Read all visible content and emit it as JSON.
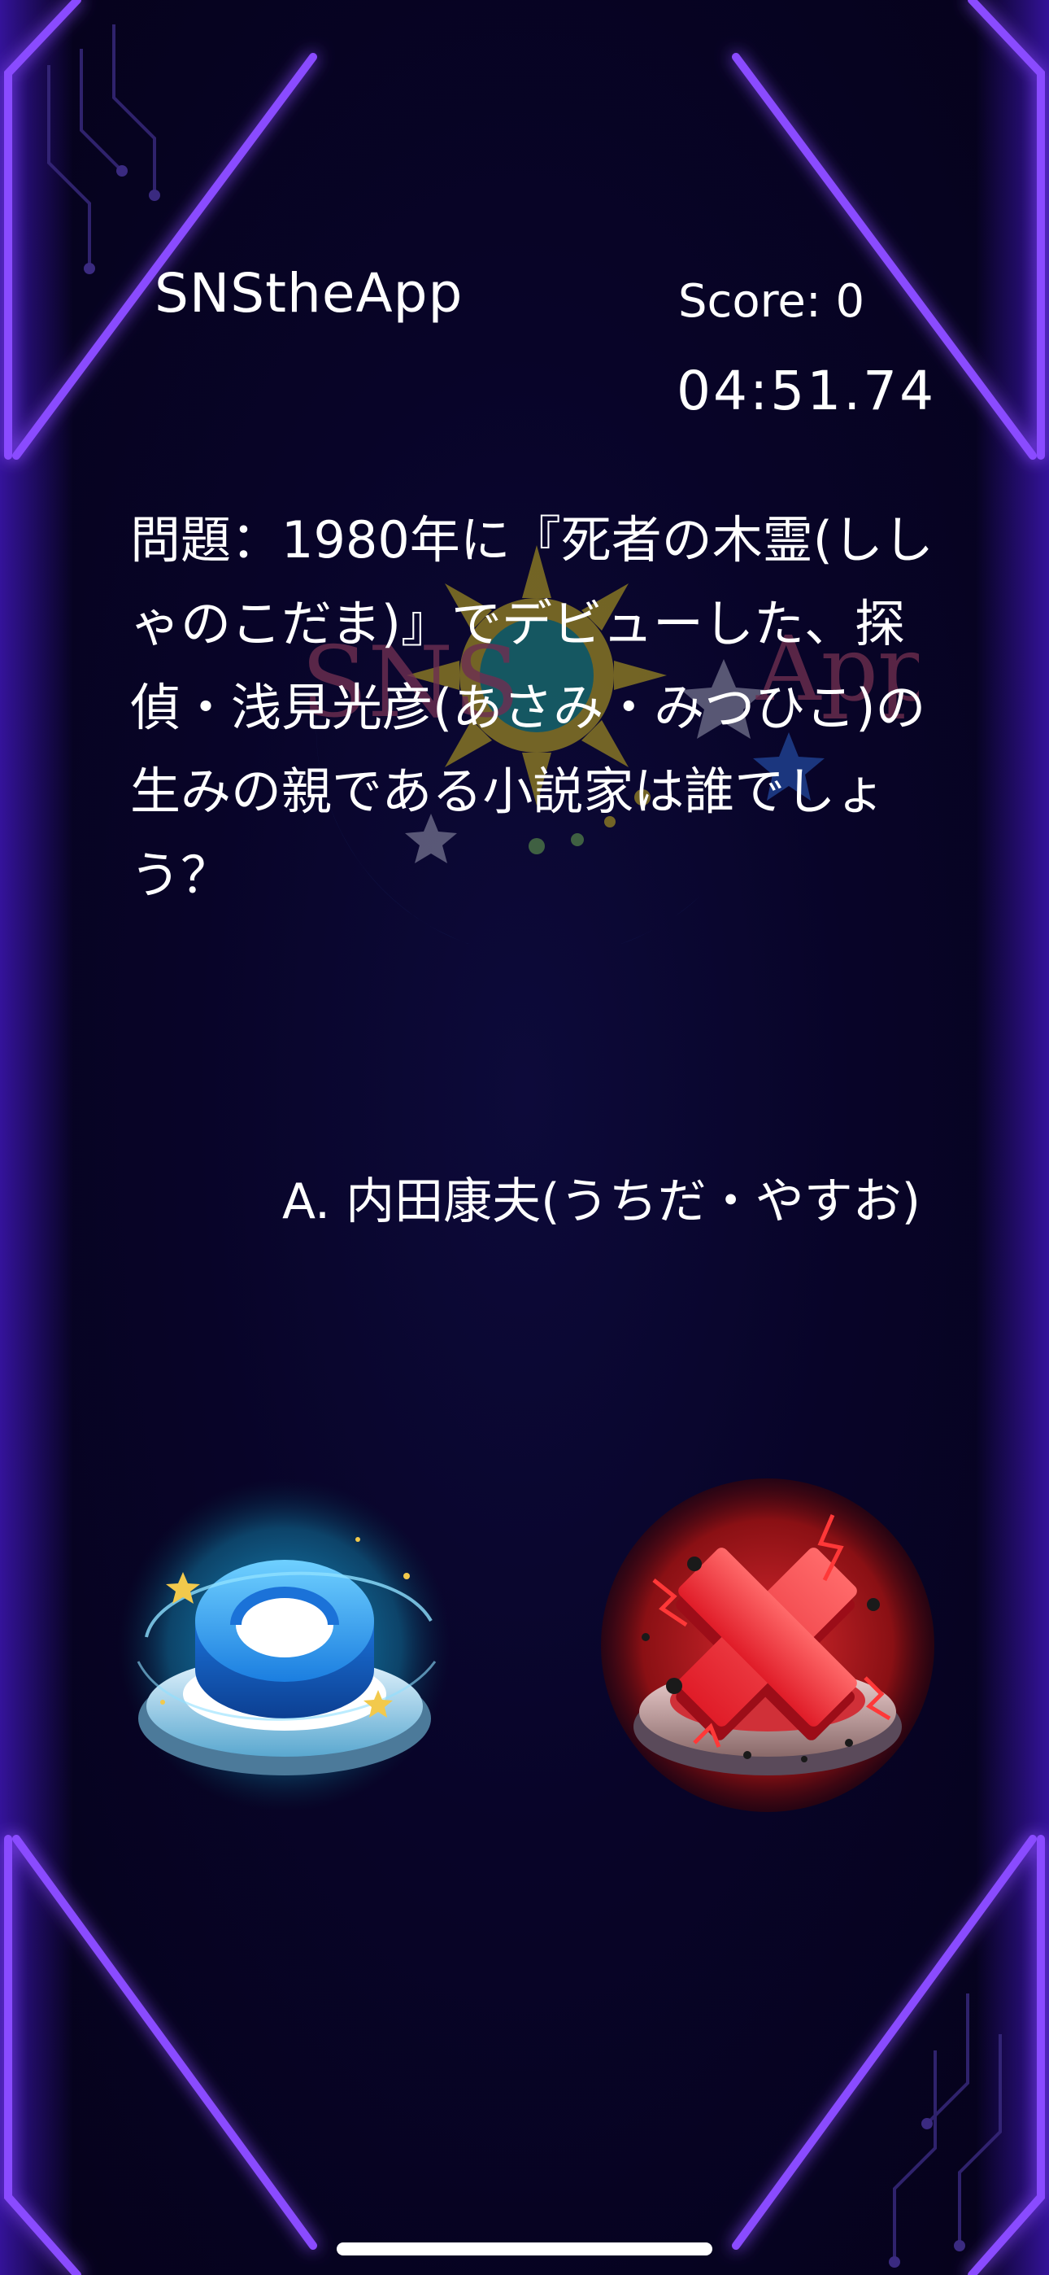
{
  "header": {
    "app_title": "SNStheApp",
    "score_label": "Score: 0",
    "timer": "04:51.74"
  },
  "logo": {
    "text": "SNS the App"
  },
  "question": {
    "text": "問題：1980年に『死者の木霊(ししゃのこだま)』でデビューした、探偵・浅見光彦(あさみ・みつひこ)の生みの親である小説家は誰でしょう？"
  },
  "answer": {
    "text": "A. 内田康夫(うちだ・やすお)"
  },
  "buttons": {
    "true_icon": "circle-o-icon",
    "false_icon": "cross-x-icon"
  },
  "colors": {
    "background": "#070320",
    "neon_frame": "#7b3cff",
    "true_accent": "#2fa3ff",
    "false_accent": "#e0202a"
  }
}
